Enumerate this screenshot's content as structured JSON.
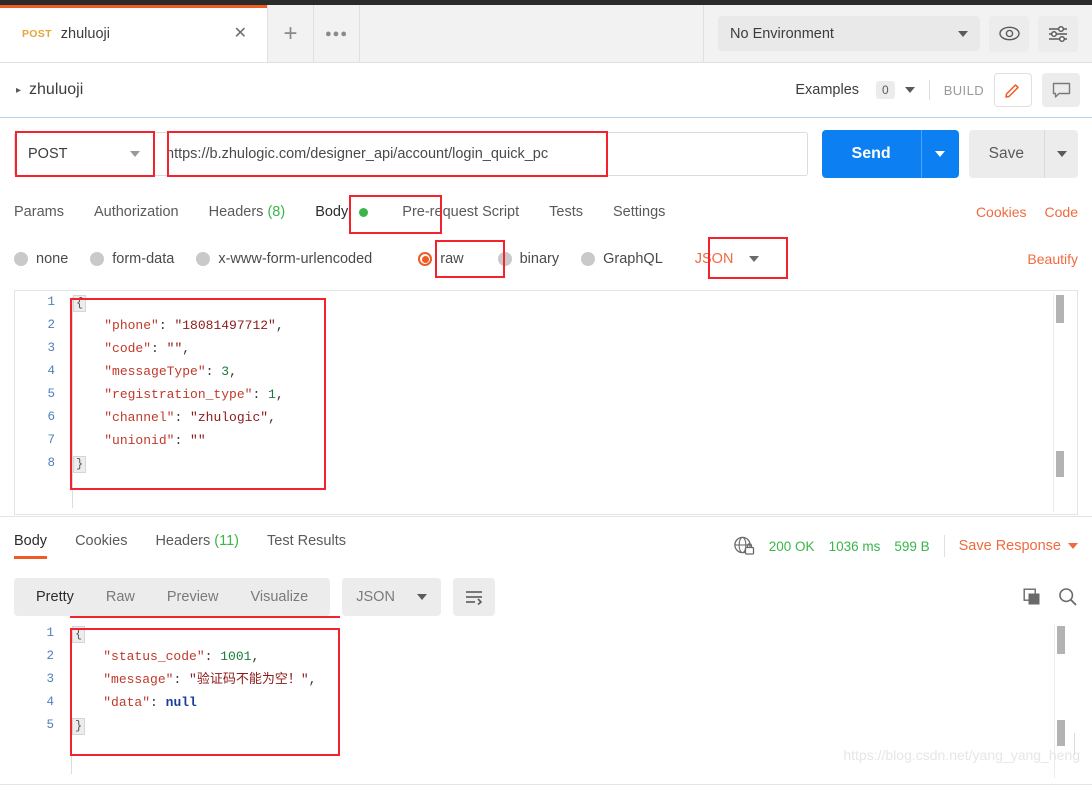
{
  "window": {
    "tab": {
      "method": "POST",
      "name": "zhuluoji",
      "close_label": "✕",
      "add_label": "+",
      "more_label": "●●●"
    },
    "environment": {
      "selected": "No Environment",
      "eye_icon": "eye-icon",
      "settings_icon": "sliders-icon"
    }
  },
  "breadcrumb": {
    "name": "zhuluoji",
    "examples_label": "Examples",
    "examples_count": "0",
    "build_label": "BUILD",
    "edit_icon": "pencil-icon",
    "comment_icon": "comment-icon"
  },
  "request": {
    "method": "POST",
    "url": "https://b.zhulogic.com/designer_api/account/login_quick_pc",
    "send_label": "Send",
    "save_label": "Save",
    "tabs": [
      {
        "label": "Params",
        "active": false
      },
      {
        "label": "Authorization",
        "active": false
      },
      {
        "label": "Headers",
        "count": "(8)",
        "active": false
      },
      {
        "label": "Body",
        "active": true,
        "dot": true
      },
      {
        "label": "Pre-request Script",
        "active": false
      },
      {
        "label": "Tests",
        "active": false
      },
      {
        "label": "Settings",
        "active": false
      }
    ],
    "links": [
      {
        "label": "Cookies"
      },
      {
        "label": "Code"
      }
    ],
    "beautify_label": "Beautify",
    "body_types": [
      {
        "label": "none",
        "selected": false
      },
      {
        "label": "form-data",
        "selected": false
      },
      {
        "label": "x-www-form-urlencoded",
        "selected": false
      },
      {
        "label": "raw",
        "selected": true
      },
      {
        "label": "binary",
        "selected": false
      },
      {
        "label": "GraphQL",
        "selected": false
      }
    ],
    "raw_format": "JSON",
    "body_lines": [
      "1",
      "2",
      "3",
      "4",
      "5",
      "6",
      "7",
      "8"
    ],
    "body_code": [
      {
        "indent": 0,
        "parts": [
          {
            "t": "fold",
            "v": "{"
          }
        ]
      },
      {
        "indent": 1,
        "parts": [
          {
            "t": "k",
            "v": "\"phone\""
          },
          {
            "t": "p",
            "v": ": "
          },
          {
            "t": "s",
            "v": "\"18081497712\""
          },
          {
            "t": "p",
            "v": ","
          }
        ]
      },
      {
        "indent": 1,
        "parts": [
          {
            "t": "k",
            "v": "\"code\""
          },
          {
            "t": "p",
            "v": ": "
          },
          {
            "t": "s",
            "v": "\"\""
          },
          {
            "t": "p",
            "v": ","
          }
        ]
      },
      {
        "indent": 1,
        "parts": [
          {
            "t": "k",
            "v": "\"messageType\""
          },
          {
            "t": "p",
            "v": ": "
          },
          {
            "t": "n",
            "v": "3"
          },
          {
            "t": "p",
            "v": ","
          }
        ]
      },
      {
        "indent": 1,
        "parts": [
          {
            "t": "k",
            "v": "\"registration_type\""
          },
          {
            "t": "p",
            "v": ": "
          },
          {
            "t": "n",
            "v": "1"
          },
          {
            "t": "p",
            "v": ","
          }
        ]
      },
      {
        "indent": 1,
        "parts": [
          {
            "t": "k",
            "v": "\"channel\""
          },
          {
            "t": "p",
            "v": ": "
          },
          {
            "t": "s",
            "v": "\"zhulogic\""
          },
          {
            "t": "p",
            "v": ","
          }
        ]
      },
      {
        "indent": 1,
        "parts": [
          {
            "t": "k",
            "v": "\"unionid\""
          },
          {
            "t": "p",
            "v": ": "
          },
          {
            "t": "s",
            "v": "\"\""
          }
        ]
      },
      {
        "indent": 0,
        "parts": [
          {
            "t": "fold",
            "v": "}"
          }
        ]
      }
    ]
  },
  "response": {
    "tabs": [
      {
        "label": "Body",
        "active": true
      },
      {
        "label": "Cookies",
        "active": false
      },
      {
        "label": "Headers",
        "count": "(11)",
        "active": false
      },
      {
        "label": "Test Results",
        "active": false
      }
    ],
    "lock_icon": "globe-lock-icon",
    "status": "200 OK",
    "time": "1036 ms",
    "size": "599 B",
    "save_response_label": "Save Response",
    "view_modes": [
      {
        "label": "Pretty",
        "active": true
      },
      {
        "label": "Raw",
        "active": false
      },
      {
        "label": "Preview",
        "active": false
      },
      {
        "label": "Visualize",
        "active": false
      }
    ],
    "format": "JSON",
    "wrap_icon": "word-wrap-icon",
    "copy_icon": "copy-icon",
    "search_icon": "search-icon",
    "body_lines": [
      "1",
      "2",
      "3",
      "4",
      "5"
    ],
    "body_code": [
      {
        "indent": 0,
        "parts": [
          {
            "t": "fold",
            "v": "{"
          }
        ]
      },
      {
        "indent": 1,
        "parts": [
          {
            "t": "k",
            "v": "\"status_code\""
          },
          {
            "t": "p",
            "v": ": "
          },
          {
            "t": "n",
            "v": "1001"
          },
          {
            "t": "p",
            "v": ","
          }
        ]
      },
      {
        "indent": 1,
        "parts": [
          {
            "t": "k",
            "v": "\"message\""
          },
          {
            "t": "p",
            "v": ": "
          },
          {
            "t": "s",
            "v": "\"验证码不能为空！\""
          },
          {
            "t": "p",
            "v": ","
          }
        ]
      },
      {
        "indent": 1,
        "parts": [
          {
            "t": "k",
            "v": "\"data\""
          },
          {
            "t": "p",
            "v": ": "
          },
          {
            "t": "nul",
            "v": "null"
          }
        ]
      },
      {
        "indent": 0,
        "parts": [
          {
            "t": "fold",
            "v": "}"
          }
        ]
      }
    ]
  },
  "watermark": "https://blog.csdn.net/yang_yang_heng",
  "colors": {
    "accent": "#ef5b25",
    "send_blue": "#0c7ff2",
    "success_green": "#3ab54a",
    "annotation_red": "#f5222d"
  }
}
